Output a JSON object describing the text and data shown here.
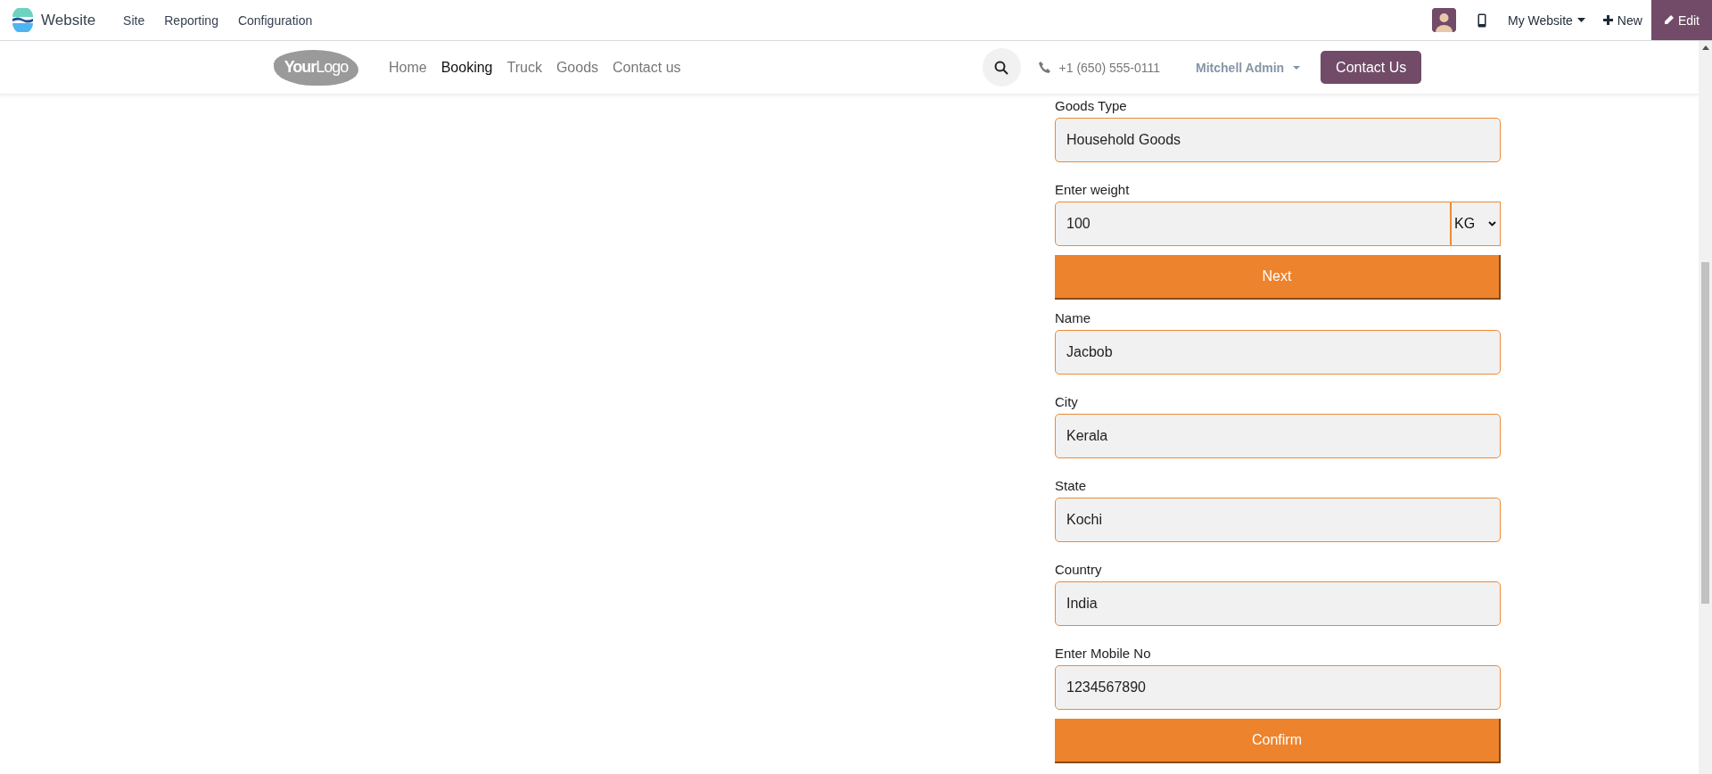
{
  "admin_bar": {
    "app_name": "Website",
    "menu": [
      "Site",
      "Reporting",
      "Configuration"
    ],
    "website_switcher": "My Website",
    "new_label": "New",
    "edit_label": "Edit"
  },
  "header": {
    "logo": "**Your**Logo",
    "nav": [
      {
        "label": "Home",
        "selected": false
      },
      {
        "label": "Booking",
        "selected": true
      },
      {
        "label": "Truck",
        "selected": false
      },
      {
        "label": "Goods",
        "selected": false
      },
      {
        "label": "Contact us",
        "selected": false
      }
    ],
    "phone": "+1 (650) 555-0111",
    "user": "Mitchell Admin",
    "cta": "Contact Us"
  },
  "form": {
    "items": [
      {
        "kind": "field",
        "label": "Goods Type",
        "value": "Household Goods"
      },
      {
        "kind": "weight",
        "label": "Enter weight",
        "value": "100",
        "unit": "KG"
      },
      {
        "kind": "button",
        "label": "Next"
      },
      {
        "kind": "field",
        "label": "Name",
        "value": "Jacbob"
      },
      {
        "kind": "field",
        "label": "City",
        "value": "Kerala"
      },
      {
        "kind": "field",
        "label": "State",
        "value": "Kochi"
      },
      {
        "kind": "field",
        "label": "Country",
        "value": "India"
      },
      {
        "kind": "field",
        "label": "Enter Mobile No",
        "value": "1234567890"
      },
      {
        "kind": "button",
        "label": "Confirm"
      }
    ]
  }
}
